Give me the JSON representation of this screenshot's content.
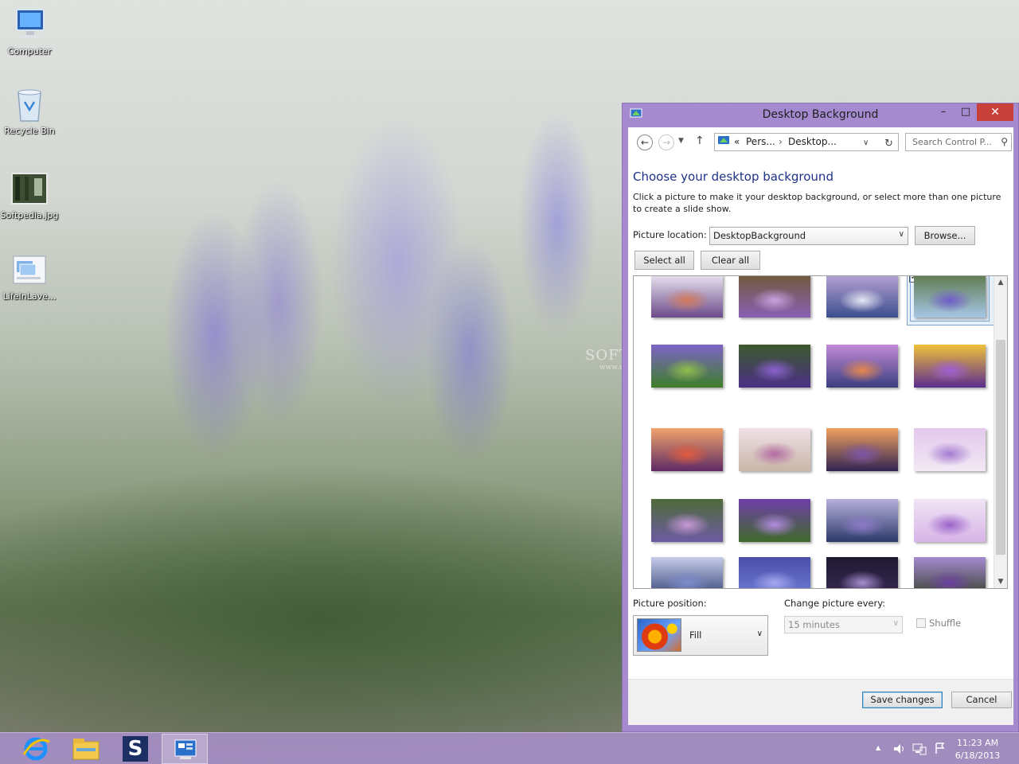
{
  "desktop": {
    "icons": [
      {
        "label": "Computer",
        "icon": "computer-icon"
      },
      {
        "label": "Recycle Bin",
        "icon": "recycle-bin-icon"
      },
      {
        "label": "Softpedia.jpg",
        "icon": "image-file-icon"
      },
      {
        "label": "LifeInLave...",
        "icon": "theme-file-icon"
      }
    ],
    "watermark": "SOFTPEDIA",
    "watermark_url": "www.softpedia.com"
  },
  "window": {
    "title": "Desktop Background",
    "controls": {
      "minimize": "–",
      "maximize": "□",
      "close": "✕"
    },
    "address": {
      "prefix": "«",
      "crumb1": "Pers...",
      "crumb2": "Desktop...",
      "separator": "›"
    },
    "search_placeholder": "Search Control P...",
    "heading": "Choose your desktop background",
    "description": "Click a picture to make it your desktop background, or select more than one picture to create a slide show.",
    "picture_location_label": "Picture location:",
    "picture_location_value": "DesktopBackground",
    "browse_label": "Browse...",
    "select_all_label": "Select all",
    "clear_all_label": "Clear all",
    "picture_position_label": "Picture position:",
    "picture_position_value": "Fill",
    "change_every_label": "Change picture every:",
    "change_every_value": "15 minutes",
    "shuffle_label": "Shuffle",
    "save_label": "Save changes",
    "cancel_label": "Cancel",
    "thumbnails": [
      {
        "colors": [
          "#6b4a8a",
          "#d27a5a",
          "#e9e4f0"
        ],
        "selected": false
      },
      {
        "colors": [
          "#8a5fb5",
          "#c9a3e0",
          "#6f5a3a"
        ],
        "selected": false
      },
      {
        "colors": [
          "#3b4f8c",
          "#e8e9f5",
          "#b7a2d6"
        ],
        "selected": false
      },
      {
        "colors": [
          "#a6c7e6",
          "#6e5ac8",
          "#5f7a4e"
        ],
        "selected": true
      },
      {
        "colors": [
          "#3e7f2a",
          "#8fbf4a",
          "#7d63c6"
        ],
        "selected": false
      },
      {
        "colors": [
          "#4a2f86",
          "#8d62d1",
          "#3c5a2c"
        ],
        "selected": false
      },
      {
        "colors": [
          "#3a3f80",
          "#e6874a",
          "#c28ad6"
        ],
        "selected": false
      },
      {
        "colors": [
          "#5b2c8e",
          "#9f5fd6",
          "#f0c13a"
        ],
        "selected": false
      },
      {
        "colors": [
          "#5e2a64",
          "#e15a3c",
          "#f0a36c"
        ],
        "selected": false
      },
      {
        "colors": [
          "#c9b6a8",
          "#b26aa0",
          "#efe0e6"
        ],
        "selected": false
      },
      {
        "colors": [
          "#2f2452",
          "#7c55a8",
          "#f0a060"
        ],
        "selected": false
      },
      {
        "colors": [
          "#f2e8f4",
          "#a47ad1",
          "#e3c8ec"
        ],
        "selected": false
      },
      {
        "colors": [
          "#6d5aa2",
          "#c89ad8",
          "#4f6b3a"
        ],
        "selected": false
      },
      {
        "colors": [
          "#3f6a2a",
          "#b38ce0",
          "#6e3fa8"
        ],
        "selected": false
      },
      {
        "colors": [
          "#2c3a6a",
          "#8d7ac8",
          "#b7b0dc"
        ],
        "selected": false
      },
      {
        "colors": [
          "#d8b4e8",
          "#9a62c8",
          "#efe4f4"
        ],
        "selected": false
      },
      {
        "colors": [
          "#2a3a70",
          "#7b8ccc",
          "#c6cbe8"
        ],
        "selected": false
      },
      {
        "colors": [
          "#6f7fd8",
          "#a8a8f0",
          "#4b4fa8"
        ],
        "selected": false
      },
      {
        "colors": [
          "#3a2a5a",
          "#a790d0",
          "#1f1a2f"
        ],
        "selected": false
      },
      {
        "colors": [
          "#2f3a22",
          "#6b3fa0",
          "#a48ad0"
        ],
        "selected": false
      }
    ]
  },
  "taskbar": {
    "items": [
      {
        "name": "internet-explorer-icon",
        "active": false
      },
      {
        "name": "file-explorer-icon",
        "active": false
      },
      {
        "name": "softpedia-icon",
        "active": false
      },
      {
        "name": "control-panel-icon",
        "active": true
      }
    ],
    "softpedia_letter": "S",
    "time": "11:23 AM",
    "date": "6/18/2013",
    "tray_up": "▲"
  },
  "colors": {
    "accent": "#a68ad0",
    "heading": "#1e3287",
    "close": "#c7403a"
  }
}
